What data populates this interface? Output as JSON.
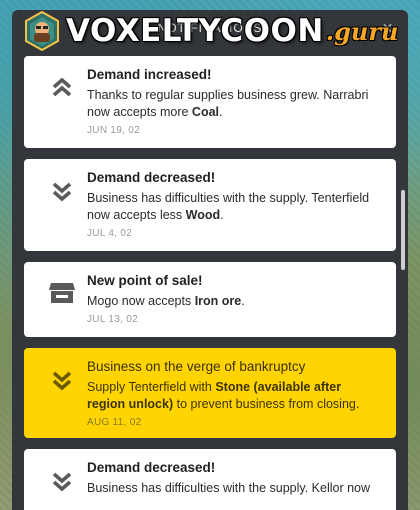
{
  "header": {
    "title": "NOTIFICATIONS",
    "close_icon": "close-icon"
  },
  "logo": {
    "brand": "VOXELTYCOON",
    "suffix": ".guru"
  },
  "notifications": [
    {
      "icon": "demand-up-icon",
      "title": "Demand increased!",
      "body_pre": "Thanks to regular supplies business grew. Narrabri now accepts more ",
      "body_bold": "Coal",
      "body_post": ".",
      "date": "JUN 19, 02",
      "type": "normal"
    },
    {
      "icon": "demand-down-icon",
      "title": "Demand decreased!",
      "body_pre": "Business has difficulties with the supply. Tenterfield now accepts less ",
      "body_bold": "Wood",
      "body_post": ".",
      "date": "JUL 4, 02",
      "type": "normal"
    },
    {
      "icon": "store-icon",
      "title": "New point of sale!",
      "body_pre": "Mogo now accepts ",
      "body_bold": "Iron ore",
      "body_post": ".",
      "date": "JUL 13, 02",
      "type": "normal"
    },
    {
      "icon": "demand-down-icon",
      "title": "Business on the verge of bankruptcy",
      "body_pre": "Supply Tenterfield with ",
      "body_bold": "Stone (available after region unlock)",
      "body_post": " to prevent business from closing.",
      "date": "AUG 11, 02",
      "type": "warning"
    },
    {
      "icon": "demand-down-icon",
      "title": "Demand decreased!",
      "body_pre": "Business has difficulties with the supply. Kellor now",
      "body_bold": "",
      "body_post": "",
      "date": "",
      "type": "normal"
    }
  ],
  "colors": {
    "panel": "#33363a",
    "card": "#ffffff",
    "warning": "#ffd400",
    "brand_accent": "#f5a623"
  }
}
